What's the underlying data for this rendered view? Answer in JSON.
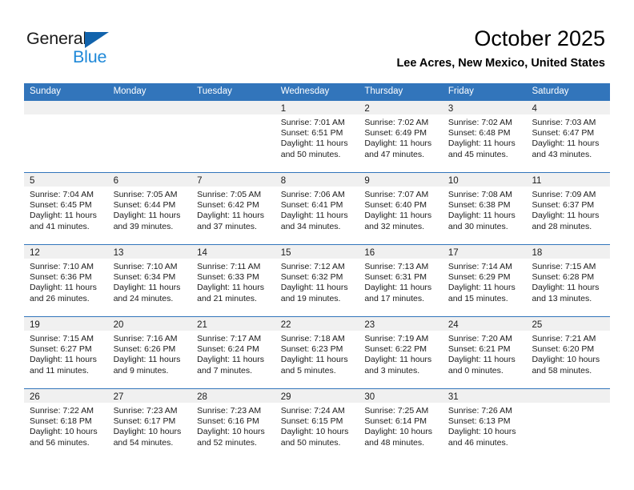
{
  "brand": {
    "name_part1": "General",
    "name_part2": "Blue",
    "triangle_icon": "triangle-icon",
    "accent_dark": "#1163ac",
    "accent_light": "#1e88d8"
  },
  "header": {
    "title": "October 2025",
    "subtitle": "Lee Acres, New Mexico, United States"
  },
  "theme": {
    "header_blue": "#3275bb",
    "day_band_gray": "#f0f0f0",
    "text": "#1b1b1b"
  },
  "weekdays": [
    "Sunday",
    "Monday",
    "Tuesday",
    "Wednesday",
    "Thursday",
    "Friday",
    "Saturday"
  ],
  "weeks": [
    [
      {
        "day": "",
        "sunrise": "",
        "sunset": "",
        "daylight1": "",
        "daylight2": "",
        "empty": true
      },
      {
        "day": "",
        "sunrise": "",
        "sunset": "",
        "daylight1": "",
        "daylight2": "",
        "empty": true
      },
      {
        "day": "",
        "sunrise": "",
        "sunset": "",
        "daylight1": "",
        "daylight2": "",
        "empty": true
      },
      {
        "day": "1",
        "sunrise": "Sunrise: 7:01 AM",
        "sunset": "Sunset: 6:51 PM",
        "daylight1": "Daylight: 11 hours",
        "daylight2": "and 50 minutes."
      },
      {
        "day": "2",
        "sunrise": "Sunrise: 7:02 AM",
        "sunset": "Sunset: 6:49 PM",
        "daylight1": "Daylight: 11 hours",
        "daylight2": "and 47 minutes."
      },
      {
        "day": "3",
        "sunrise": "Sunrise: 7:02 AM",
        "sunset": "Sunset: 6:48 PM",
        "daylight1": "Daylight: 11 hours",
        "daylight2": "and 45 minutes."
      },
      {
        "day": "4",
        "sunrise": "Sunrise: 7:03 AM",
        "sunset": "Sunset: 6:47 PM",
        "daylight1": "Daylight: 11 hours",
        "daylight2": "and 43 minutes."
      }
    ],
    [
      {
        "day": "5",
        "sunrise": "Sunrise: 7:04 AM",
        "sunset": "Sunset: 6:45 PM",
        "daylight1": "Daylight: 11 hours",
        "daylight2": "and 41 minutes."
      },
      {
        "day": "6",
        "sunrise": "Sunrise: 7:05 AM",
        "sunset": "Sunset: 6:44 PM",
        "daylight1": "Daylight: 11 hours",
        "daylight2": "and 39 minutes."
      },
      {
        "day": "7",
        "sunrise": "Sunrise: 7:05 AM",
        "sunset": "Sunset: 6:42 PM",
        "daylight1": "Daylight: 11 hours",
        "daylight2": "and 37 minutes."
      },
      {
        "day": "8",
        "sunrise": "Sunrise: 7:06 AM",
        "sunset": "Sunset: 6:41 PM",
        "daylight1": "Daylight: 11 hours",
        "daylight2": "and 34 minutes."
      },
      {
        "day": "9",
        "sunrise": "Sunrise: 7:07 AM",
        "sunset": "Sunset: 6:40 PM",
        "daylight1": "Daylight: 11 hours",
        "daylight2": "and 32 minutes."
      },
      {
        "day": "10",
        "sunrise": "Sunrise: 7:08 AM",
        "sunset": "Sunset: 6:38 PM",
        "daylight1": "Daylight: 11 hours",
        "daylight2": "and 30 minutes."
      },
      {
        "day": "11",
        "sunrise": "Sunrise: 7:09 AM",
        "sunset": "Sunset: 6:37 PM",
        "daylight1": "Daylight: 11 hours",
        "daylight2": "and 28 minutes."
      }
    ],
    [
      {
        "day": "12",
        "sunrise": "Sunrise: 7:10 AM",
        "sunset": "Sunset: 6:36 PM",
        "daylight1": "Daylight: 11 hours",
        "daylight2": "and 26 minutes."
      },
      {
        "day": "13",
        "sunrise": "Sunrise: 7:10 AM",
        "sunset": "Sunset: 6:34 PM",
        "daylight1": "Daylight: 11 hours",
        "daylight2": "and 24 minutes."
      },
      {
        "day": "14",
        "sunrise": "Sunrise: 7:11 AM",
        "sunset": "Sunset: 6:33 PM",
        "daylight1": "Daylight: 11 hours",
        "daylight2": "and 21 minutes."
      },
      {
        "day": "15",
        "sunrise": "Sunrise: 7:12 AM",
        "sunset": "Sunset: 6:32 PM",
        "daylight1": "Daylight: 11 hours",
        "daylight2": "and 19 minutes."
      },
      {
        "day": "16",
        "sunrise": "Sunrise: 7:13 AM",
        "sunset": "Sunset: 6:31 PM",
        "daylight1": "Daylight: 11 hours",
        "daylight2": "and 17 minutes."
      },
      {
        "day": "17",
        "sunrise": "Sunrise: 7:14 AM",
        "sunset": "Sunset: 6:29 PM",
        "daylight1": "Daylight: 11 hours",
        "daylight2": "and 15 minutes."
      },
      {
        "day": "18",
        "sunrise": "Sunrise: 7:15 AM",
        "sunset": "Sunset: 6:28 PM",
        "daylight1": "Daylight: 11 hours",
        "daylight2": "and 13 minutes."
      }
    ],
    [
      {
        "day": "19",
        "sunrise": "Sunrise: 7:15 AM",
        "sunset": "Sunset: 6:27 PM",
        "daylight1": "Daylight: 11 hours",
        "daylight2": "and 11 minutes."
      },
      {
        "day": "20",
        "sunrise": "Sunrise: 7:16 AM",
        "sunset": "Sunset: 6:26 PM",
        "daylight1": "Daylight: 11 hours",
        "daylight2": "and 9 minutes."
      },
      {
        "day": "21",
        "sunrise": "Sunrise: 7:17 AM",
        "sunset": "Sunset: 6:24 PM",
        "daylight1": "Daylight: 11 hours",
        "daylight2": "and 7 minutes."
      },
      {
        "day": "22",
        "sunrise": "Sunrise: 7:18 AM",
        "sunset": "Sunset: 6:23 PM",
        "daylight1": "Daylight: 11 hours",
        "daylight2": "and 5 minutes."
      },
      {
        "day": "23",
        "sunrise": "Sunrise: 7:19 AM",
        "sunset": "Sunset: 6:22 PM",
        "daylight1": "Daylight: 11 hours",
        "daylight2": "and 3 minutes."
      },
      {
        "day": "24",
        "sunrise": "Sunrise: 7:20 AM",
        "sunset": "Sunset: 6:21 PM",
        "daylight1": "Daylight: 11 hours",
        "daylight2": "and 0 minutes."
      },
      {
        "day": "25",
        "sunrise": "Sunrise: 7:21 AM",
        "sunset": "Sunset: 6:20 PM",
        "daylight1": "Daylight: 10 hours",
        "daylight2": "and 58 minutes."
      }
    ],
    [
      {
        "day": "26",
        "sunrise": "Sunrise: 7:22 AM",
        "sunset": "Sunset: 6:18 PM",
        "daylight1": "Daylight: 10 hours",
        "daylight2": "and 56 minutes."
      },
      {
        "day": "27",
        "sunrise": "Sunrise: 7:23 AM",
        "sunset": "Sunset: 6:17 PM",
        "daylight1": "Daylight: 10 hours",
        "daylight2": "and 54 minutes."
      },
      {
        "day": "28",
        "sunrise": "Sunrise: 7:23 AM",
        "sunset": "Sunset: 6:16 PM",
        "daylight1": "Daylight: 10 hours",
        "daylight2": "and 52 minutes."
      },
      {
        "day": "29",
        "sunrise": "Sunrise: 7:24 AM",
        "sunset": "Sunset: 6:15 PM",
        "daylight1": "Daylight: 10 hours",
        "daylight2": "and 50 minutes."
      },
      {
        "day": "30",
        "sunrise": "Sunrise: 7:25 AM",
        "sunset": "Sunset: 6:14 PM",
        "daylight1": "Daylight: 10 hours",
        "daylight2": "and 48 minutes."
      },
      {
        "day": "31",
        "sunrise": "Sunrise: 7:26 AM",
        "sunset": "Sunset: 6:13 PM",
        "daylight1": "Daylight: 10 hours",
        "daylight2": "and 46 minutes."
      },
      {
        "day": "",
        "sunrise": "",
        "sunset": "",
        "daylight1": "",
        "daylight2": "",
        "empty": true
      }
    ]
  ]
}
